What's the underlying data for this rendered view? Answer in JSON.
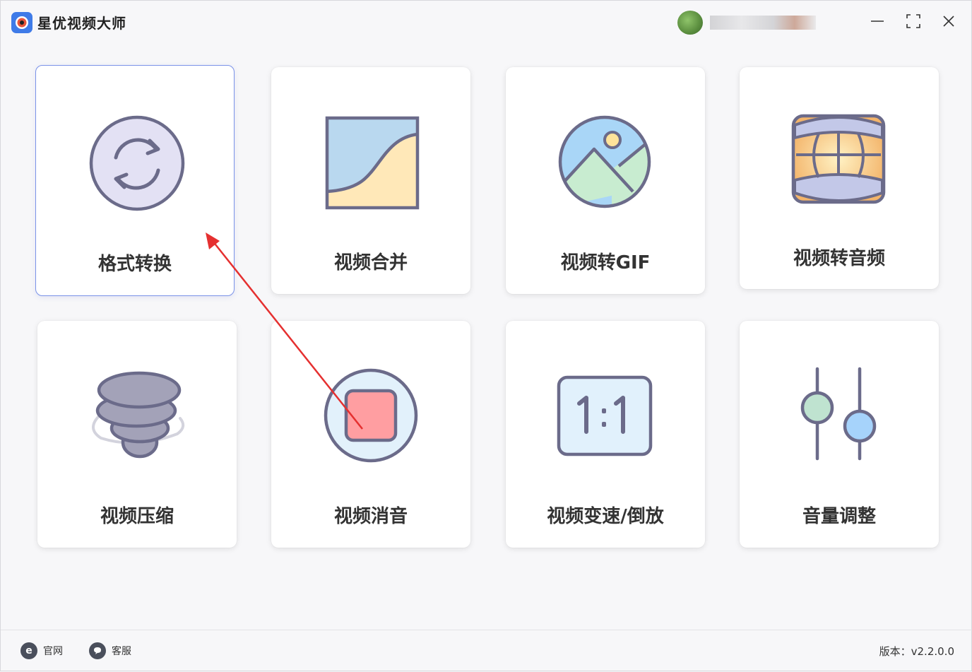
{
  "app": {
    "title": "星优视频大师"
  },
  "window_controls": {
    "minimize": "—",
    "maximize": "⛶",
    "close": "✕"
  },
  "cards": [
    {
      "label": "格式转换",
      "icon": "convert-arrows-icon"
    },
    {
      "label": "视频合并",
      "icon": "merge-icon"
    },
    {
      "label": "视频转GIF",
      "icon": "image-landscape-icon"
    },
    {
      "label": "视频转音频",
      "icon": "audio-wide-icon"
    },
    {
      "label": "视频压缩",
      "icon": "tornado-compress-icon"
    },
    {
      "label": "视频消音",
      "icon": "stop-mute-icon"
    },
    {
      "label": "视频变速/倒放",
      "icon": "ratio-1-1-icon"
    },
    {
      "label": "音量调整",
      "icon": "sliders-icon"
    }
  ],
  "footer": {
    "website_label": "官网",
    "support_label": "客服",
    "version": "版本：v2.2.0.0"
  },
  "colors": {
    "accent_border": "#7a92e8",
    "annotation_arrow": "#e53030",
    "icon_stroke": "#6b6b8a"
  }
}
